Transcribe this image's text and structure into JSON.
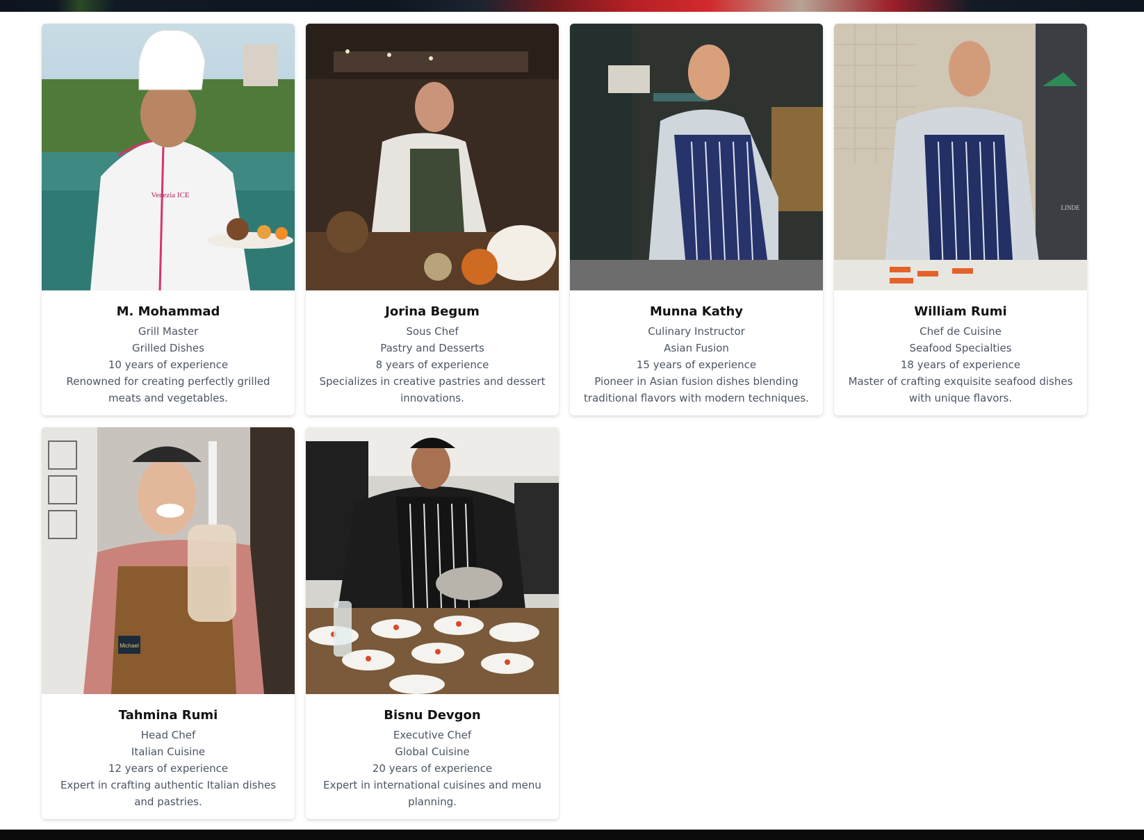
{
  "chefs": [
    {
      "name": "M. Mohammad",
      "title": "Grill Master",
      "specialty": "Grilled Dishes",
      "experience": "10 years of experience",
      "bio": "Renowned for creating perfectly grilled meats and vegetables."
    },
    {
      "name": "Jorina Begum",
      "title": "Sous Chef",
      "specialty": "Pastry and Desserts",
      "experience": "8 years of experience",
      "bio": "Specializes in creative pastries and dessert innovations."
    },
    {
      "name": "Munna Kathy",
      "title": "Culinary Instructor",
      "specialty": "Asian Fusion",
      "experience": "15 years of experience",
      "bio": "Pioneer in Asian fusion dishes blending traditional flavors with modern techniques."
    },
    {
      "name": "William Rumi",
      "title": "Chef de Cuisine",
      "specialty": "Seafood Specialties",
      "experience": "18 years of experience",
      "bio": "Master of crafting exquisite seafood dishes with unique flavors."
    },
    {
      "name": "Tahmina Rumi",
      "title": "Head Chef",
      "specialty": "Italian Cuisine",
      "experience": "12 years of experience",
      "bio": "Expert in crafting authentic Italian dishes and pastries."
    },
    {
      "name": "Bisnu Devgon",
      "title": "Executive Chef",
      "specialty": "Global Cuisine",
      "experience": "20 years of experience",
      "bio": "Expert in international cuisines and menu planning."
    }
  ],
  "photo_text": {
    "shirt_logo": "Venezia ICE",
    "name_tag": "Michael",
    "wall_sign": "LINDE"
  },
  "colors": {
    "card_bg": "#ffffff",
    "text_primary": "#111111",
    "text_secondary": "#4b5563",
    "page_bg": "#ffffff",
    "footer_bar": "#0b0b0b"
  }
}
